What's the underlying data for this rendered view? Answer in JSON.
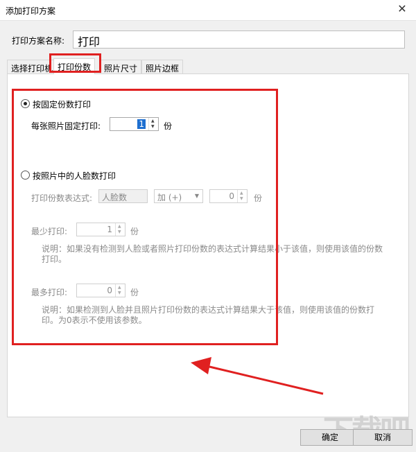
{
  "window": {
    "title": "添加打印方案",
    "close_glyph": "✕"
  },
  "scheme": {
    "label": "打印方案名称:",
    "value": "打印"
  },
  "tabs": [
    {
      "label": "选择打印机",
      "active": false
    },
    {
      "label": "打印份数",
      "active": true
    },
    {
      "label": "照片尺寸",
      "active": false
    },
    {
      "label": "照片边框",
      "active": false
    }
  ],
  "fixed": {
    "radio_label": "按固定份数打印",
    "checked": true,
    "per_photo_label": "每张照片固定打印:",
    "per_photo_value": "1",
    "unit": "份"
  },
  "face": {
    "radio_label": "按照片中的人脸数打印",
    "checked": false,
    "expr_label": "打印份数表达式:",
    "expr_value": "人脸数",
    "op_value": "加 (+)",
    "op_num": "0",
    "unit": "份",
    "min_label": "最少打印:",
    "min_value": "1",
    "min_note": "说明：如果没有检测到人脸或者照片打印份数的表达式计算结果小于该值，则使用该值的份数打印。",
    "max_label": "最多打印:",
    "max_value": "0",
    "max_note": "说明：如果检测到人脸并且照片打印份数的表达式计算结果大于该值，则使用该值的份数打印。为0表示不使用该参数。"
  },
  "buttons": {
    "ok": "确定",
    "cancel": "取消"
  },
  "watermark": "下载吧",
  "colors": {
    "annotation": "#e02020",
    "selection": "#1e6fd0"
  }
}
